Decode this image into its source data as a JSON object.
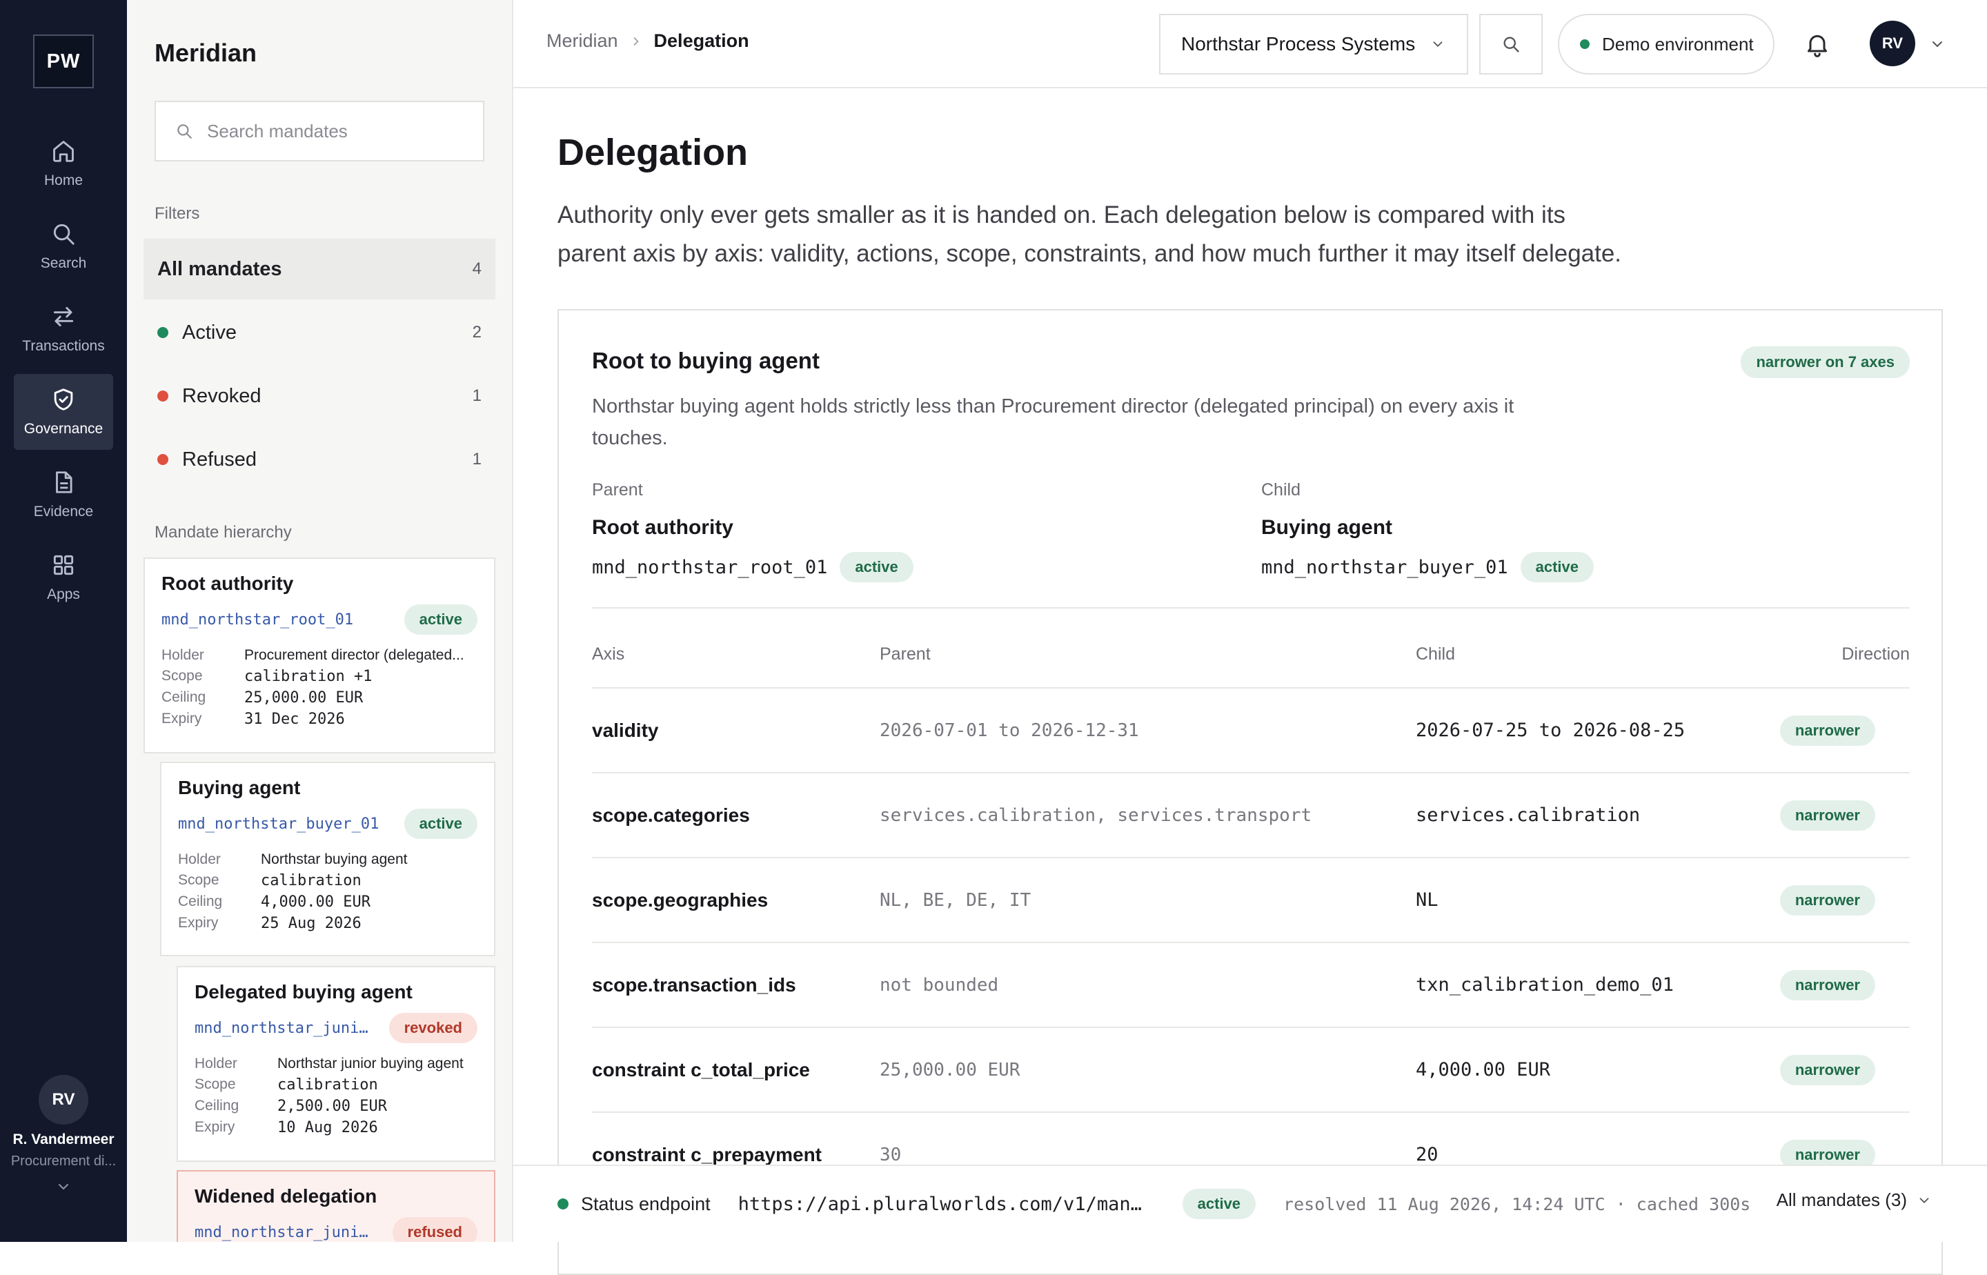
{
  "app": {
    "logo": "PW",
    "nav": [
      {
        "label": "Home",
        "icon": "home-icon"
      },
      {
        "label": "Search",
        "icon": "search-icon"
      },
      {
        "label": "Transactions",
        "icon": "transfer-icon"
      },
      {
        "label": "Governance",
        "icon": "shield-icon",
        "active": true
      },
      {
        "label": "Evidence",
        "icon": "document-icon"
      },
      {
        "label": "Apps",
        "icon": "grid-icon"
      }
    ],
    "user": {
      "initials": "RV",
      "name": "R. Vandermeer",
      "role": "Procurement di..."
    }
  },
  "sidebar": {
    "title": "Meridian",
    "search_placeholder": "Search mandates",
    "filters_label": "Filters",
    "filters": [
      {
        "label": "All mandates",
        "count": "4"
      },
      {
        "label": "Active",
        "count": "2",
        "color": "#1f8a5c"
      },
      {
        "label": "Revoked",
        "count": "1",
        "color": "#e0503f"
      },
      {
        "label": "Refused",
        "count": "1",
        "color": "#e0503f"
      }
    ],
    "hierarchy_label": "Mandate hierarchy",
    "mandates": [
      {
        "title": "Root authority",
        "id": "mnd_northstar_root_01",
        "status": "active",
        "holder_label": "Holder",
        "holder": "Procurement director (delegated...",
        "scope_label": "Scope",
        "scope": "calibration +1",
        "ceiling_label": "Ceiling",
        "ceiling": "25,000.00 EUR",
        "expiry_label": "Expiry",
        "expiry": "31 Dec 2026"
      },
      {
        "title": "Buying agent",
        "id": "mnd_northstar_buyer_01",
        "status": "active",
        "holder_label": "Holder",
        "holder": "Northstar buying agent",
        "scope_label": "Scope",
        "scope": "calibration",
        "ceiling_label": "Ceiling",
        "ceiling": "4,000.00 EUR",
        "expiry_label": "Expiry",
        "expiry": "25 Aug 2026"
      },
      {
        "title": "Delegated buying agent",
        "id": "mnd_northstar_juni…",
        "status": "revoked",
        "holder_label": "Holder",
        "holder": "Northstar junior buying agent",
        "scope_label": "Scope",
        "scope": "calibration",
        "ceiling_label": "Ceiling",
        "ceiling": "2,500.00 EUR",
        "expiry_label": "Expiry",
        "expiry": "10 Aug 2026"
      },
      {
        "title": "Widened delegation",
        "id": "mnd_northstar_junio…",
        "status": "refused"
      }
    ]
  },
  "topbar": {
    "breadcrumb": [
      "Meridian",
      "Delegation"
    ],
    "org": "Northstar Process Systems",
    "environment": "Demo environment",
    "environment_color": "#1f8a5c",
    "user_initials": "RV"
  },
  "main": {
    "title": "Delegation",
    "description": "Authority only ever gets smaller as it is handed on. Each delegation below is compared with its parent axis by axis: validity, actions, scope, constraints, and how much further it may itself delegate.",
    "panel": {
      "title": "Root to buying agent",
      "badge": "narrower on 7 axes",
      "description": "Northstar buying agent holds strictly less than Procurement director (delegated principal) on every axis it touches.",
      "parent": {
        "label": "Parent",
        "name": "Root authority",
        "id": "mnd_northstar_root_01",
        "status": "active"
      },
      "child": {
        "label": "Child",
        "name": "Buying agent",
        "id": "mnd_northstar_buyer_01",
        "status": "active"
      },
      "columns": [
        "Axis",
        "Parent",
        "Child",
        "Direction"
      ],
      "rows": [
        {
          "axis": "validity",
          "parent": "2026-07-01 to 2026-12-31",
          "child": "2026-07-25 to 2026-08-25",
          "direction": "narrower"
        },
        {
          "axis": "scope.categories",
          "parent": "services.calibration, services.transport",
          "child": "services.calibration",
          "direction": "narrower"
        },
        {
          "axis": "scope.geographies",
          "parent": "NL, BE, DE, IT",
          "child": "NL",
          "direction": "narrower"
        },
        {
          "axis": "scope.transaction_ids",
          "parent": "not bounded",
          "child": "txn_calibration_demo_01",
          "direction": "narrower"
        },
        {
          "axis": "constraint c_total_price",
          "parent": "25,000.00 EUR",
          "child": "4,000.00 EUR",
          "direction": "narrower"
        },
        {
          "axis": "constraint c_prepayment",
          "parent": "30",
          "child": "20",
          "direction": "narrower"
        }
      ]
    }
  },
  "statusbar": {
    "label": "Status endpoint",
    "url": "https://api.pluralworlds.com/v1/manda...",
    "status": "active",
    "resolved": "resolved 11 Aug 2026, 14:24 UTC · cached 300s",
    "scope": "All mandates (3)",
    "dot_color": "#1f8a5c"
  }
}
